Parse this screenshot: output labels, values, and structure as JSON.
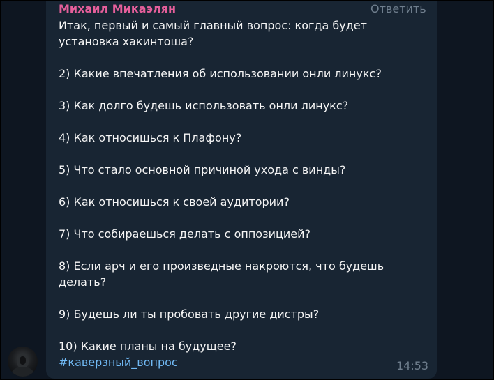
{
  "message": {
    "sender": "Михаил Микаэлян",
    "reply_label": "Ответить",
    "paragraphs": [
      "Итак, первый и самый главный вопрос: когда будет установка хакинтоша?",
      "2) Какие впечатления об использовании онли линукс?",
      "3) Как долго будешь использовать онли линукс?",
      "4) Как относишься к Плафону?",
      "5) Что стало основной причиной ухода с винды?",
      "6) Как относишься к своей аудитории?",
      "7) Что собираешься делать с оппозицией?",
      "8) Если арч и его произведные накроются, что будешь делать?",
      "9) Будешь ли ты пробовать другие дистры?",
      "10) Какие планы на будущее?"
    ],
    "hashtag": "#каверзный_вопрос",
    "time": "14:53"
  },
  "colors": {
    "background": "#0e1621",
    "bubble": "#182533",
    "sender": "#e65f9b",
    "text": "#f5f5f5",
    "link": "#71baf5",
    "muted": "#6f7e8d"
  },
  "icons": {
    "avatar": "user-avatar"
  }
}
